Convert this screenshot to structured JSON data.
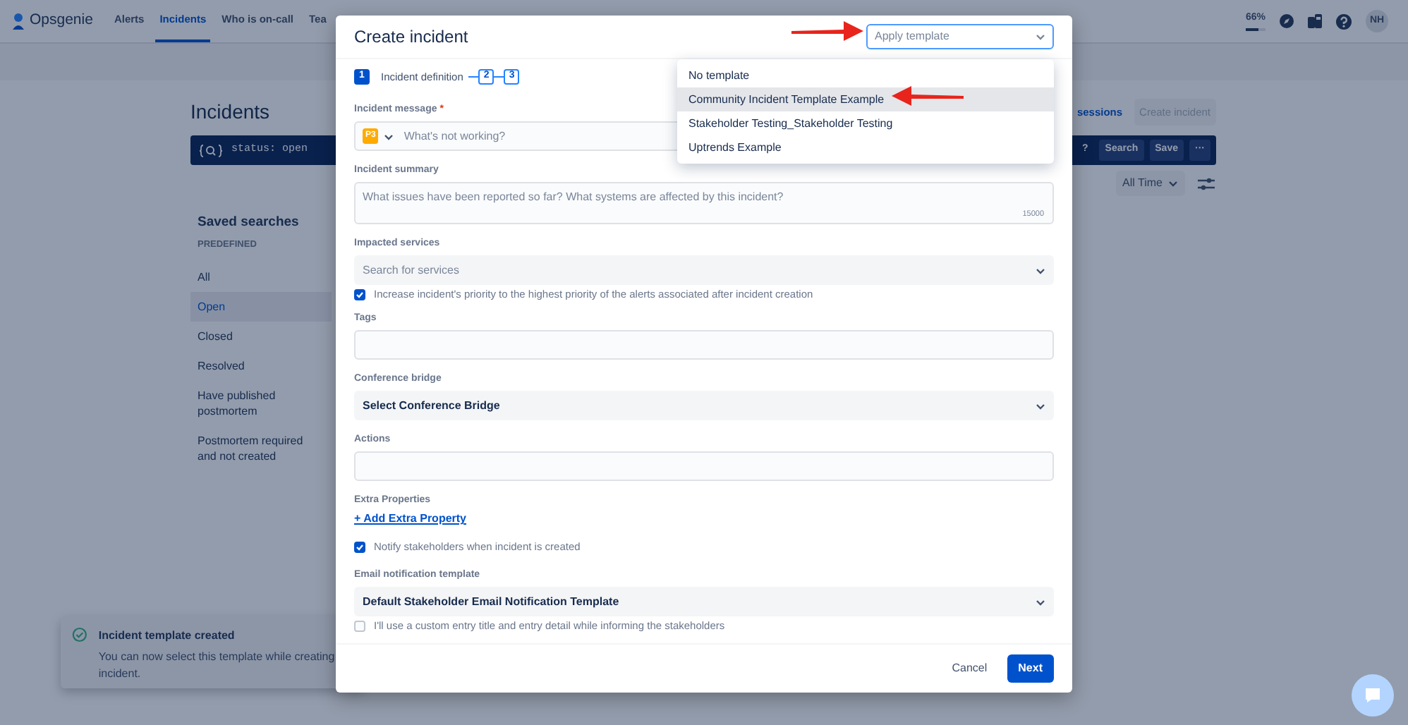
{
  "navbar": {
    "logo": "Opsgenie",
    "tabs": [
      {
        "label": "Alerts",
        "selected": false
      },
      {
        "label": "Incidents",
        "selected": true
      },
      {
        "label": "Who is on-call",
        "selected": false
      },
      {
        "label": "Tea",
        "selected": false
      }
    ],
    "usage": {
      "text": "66%",
      "level": 0.66
    },
    "avatar": "NH"
  },
  "page": {
    "title": "Incidents",
    "sessions_link": "sessions",
    "create_button": {
      "label": "Create incident",
      "disabled": true
    },
    "query": "status: open",
    "query_buttons": [
      "?",
      "Search",
      "Save",
      "···"
    ],
    "time_filter": "All Time"
  },
  "saved_searches": {
    "title": "Saved searches",
    "section": "PREDEFINED",
    "items": [
      {
        "label": "All",
        "selected": false
      },
      {
        "label": "Open",
        "selected": true
      },
      {
        "label": "Closed",
        "selected": false
      },
      {
        "label": "Resolved",
        "selected": false
      },
      {
        "label": "Have published postmortem",
        "selected": false
      },
      {
        "label": "Postmortem required and not created",
        "selected": false
      }
    ]
  },
  "toast": {
    "title": "Incident template created",
    "message": "You can now select this template while creating incident."
  },
  "modal": {
    "title": "Create incident",
    "template_select": {
      "placeholder": "Apply template",
      "options": [
        {
          "label": "No template",
          "selected": false
        },
        {
          "label": "Community Incident Template Example",
          "selected": true
        },
        {
          "label": "Stakeholder Testing_Stakeholder Testing",
          "selected": false
        },
        {
          "label": "Uptrends Example",
          "selected": false
        }
      ]
    },
    "steps": [
      {
        "number": "1",
        "label": "Incident definition",
        "active": true
      },
      {
        "number": "2",
        "active": false
      },
      {
        "number": "3",
        "active": false
      }
    ],
    "fields": [
      {
        "kind": "input",
        "label": "Incident message",
        "required_mark": "*",
        "priority": "P3",
        "placeholder": "What's not working?"
      },
      {
        "kind": "textarea",
        "label": "Incident summary",
        "placeholder": "What issues have been reported so far? What systems are affected by this incident?",
        "counter": "15000"
      },
      {
        "kind": "select",
        "label": "Impacted services",
        "placeholder": "Search for services"
      },
      {
        "kind": "checkbox",
        "label": "Increase incident's priority to the highest priority of the alerts associated after incident creation",
        "checked": true
      },
      {
        "kind": "input",
        "label": "Tags"
      },
      {
        "kind": "select",
        "label": "Conference bridge",
        "value": "Select Conference Bridge"
      },
      {
        "kind": "input",
        "label": "Actions"
      },
      {
        "kind": "link",
        "label": "Extra Properties",
        "text": "+ Add Extra Property"
      },
      {
        "kind": "checkbox",
        "label": "Notify stakeholders when incident is created",
        "checked": true
      },
      {
        "kind": "select",
        "label": "Email notification template",
        "value": "Default Stakeholder Email Notification Template"
      },
      {
        "kind": "checkbox",
        "label": "I'll use a custom entry title and entry detail while informing the stakeholders",
        "checked": false
      }
    ],
    "cancel": "Cancel",
    "next": "Next"
  }
}
